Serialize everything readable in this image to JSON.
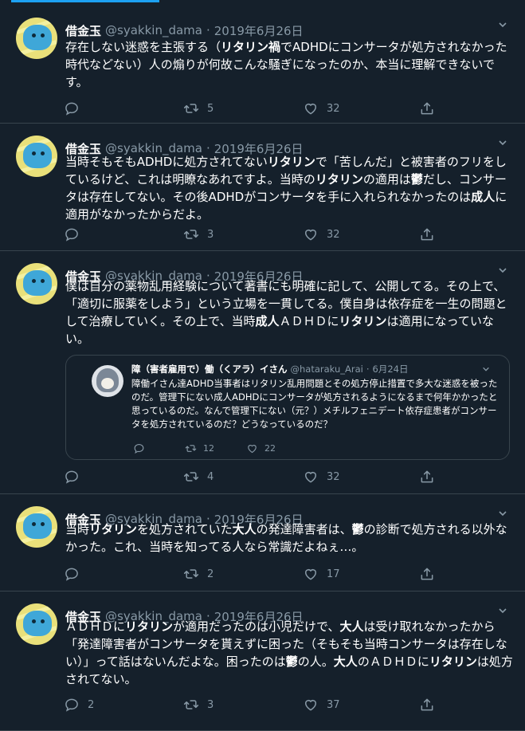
{
  "tweets": [
    {
      "name": "借金玉",
      "handle": "@syakkin_dama",
      "dot": "·",
      "date": "2019年6月26日",
      "text_html": "存在しない迷惑を主張する（<b>リタリン禍</b>でADHDにコンサータが処方されなかった時代などない）人の煽りが何故こんな騒ぎになったのか、本当に理解できないです。",
      "reply_count": "",
      "retweet_count": "5",
      "like_count": "32"
    },
    {
      "name": "借金玉",
      "handle": "@syakkin_dama",
      "dot": "·",
      "date": "2019年6月26日",
      "text_html": "当時そもそもADHDに処方されてない<b>リタリン</b>で「苦しんだ」と被害者のフリをしているけど、これは明瞭なあれですよ。当時の<b>リタリン</b>の適用は<b>鬱</b>だし、コンサータは存在してない。その後ADHDがコンサータを手に入れられなかったのは<b>成人</b>に適用がなかったからだよ。",
      "reply_count": "",
      "retweet_count": "3",
      "like_count": "32"
    },
    {
      "name": "借金玉",
      "handle": "@syakkin_dama",
      "dot": "·",
      "date": "2019年6月26日",
      "text_html": "僕は自分の薬物乱用経験について著書にも明確に記して、公開してる。その上で、「適切に服薬をしよう」という立場を一貫してる。僕自身は依存症を一生の問題として治療していく。その上で、当時<b>成人</b>ＡＤＨＤに<b>リタリン</b>は適用になっていない。",
      "reply_count": "",
      "retweet_count": "4",
      "like_count": "32"
    },
    {
      "name": "借金玉",
      "handle": "@syakkin_dama",
      "dot": "·",
      "date": "2019年6月26日",
      "text_html": "当時<b>リタリン</b>を処方されていた<b>大人</b>の発達障害者は、<b>鬱</b>の診断で処方される以外なかった。これ、当時を知ってる人なら常識だよねぇ…。",
      "reply_count": "",
      "retweet_count": "2",
      "like_count": "17"
    },
    {
      "name": "借金玉",
      "handle": "@syakkin_dama",
      "dot": "·",
      "date": "2019年6月26日",
      "text_html": "ＡＤＨＤに<b>リタリン</b>が適用だったのは小児だけで、<b>大人</b>は受け取れなかったから「発達障害者がコンサータを貰えずに困った（そもそも当時コンサータは存在しない）」って話はないんだよな。困ったのは<b>鬱</b>の人。<b>大人</b>のＡＤＨＤに<b>リタリン</b>は処方されてない。",
      "reply_count": "2",
      "retweet_count": "3",
      "like_count": "37"
    }
  ],
  "quote": {
    "name": "障（害者雇用で）働（くアラ）イさん",
    "handle": "@hataraku_Arai",
    "dot": "·",
    "date": "6月24日",
    "text": "障働イさん達ADHD当事者はリタリン乱用問題とその処方停止措置で多大な迷惑を被ったのだ。管理下にない成人ADHDにコンサータが処方されるようになるまで何年かかったと思っているのだ。なんで管理下にない（元？）メチルフェニデート依存症患者がコンサータを処方されているのだ？どうなっているのだ？",
    "reply_count": "",
    "retweet_count": "12",
    "like_count": "22"
  },
  "icons": {
    "reply": "reply-icon",
    "retweet": "retweet-icon",
    "like": "heart-icon",
    "share": "share-icon",
    "menu": "chevron-down-icon"
  },
  "colors": {
    "background": "#15202b",
    "text": "#ffffff",
    "secondary": "#8899a6",
    "divider": "#38444d",
    "accent": "#1da1f2"
  }
}
